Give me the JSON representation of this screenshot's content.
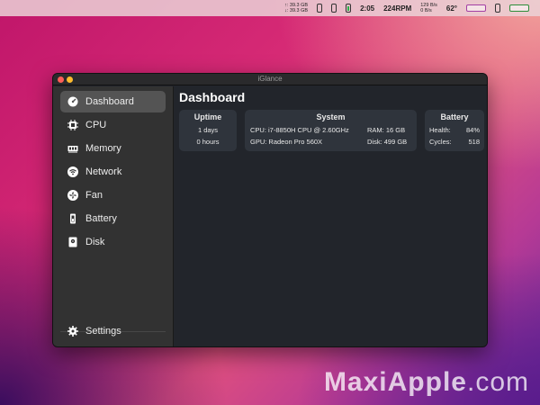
{
  "menubar": {
    "net_upload": "↑: 39.3 GB",
    "net_download": "↓: 39.3 GB",
    "time": "2:05",
    "fan": "224RPM",
    "net_rate_up": "129 B/s",
    "net_rate_down": "0 B/s",
    "temp": "62°"
  },
  "window": {
    "title": "iGlance"
  },
  "sidebar": {
    "items": [
      {
        "label": "Dashboard",
        "icon": "gauge-icon"
      },
      {
        "label": "CPU",
        "icon": "cpu-icon"
      },
      {
        "label": "Memory",
        "icon": "memory-icon"
      },
      {
        "label": "Network",
        "icon": "wifi-icon"
      },
      {
        "label": "Fan",
        "icon": "fan-icon"
      },
      {
        "label": "Battery",
        "icon": "battery-icon"
      },
      {
        "label": "Disk",
        "icon": "disk-icon"
      }
    ],
    "settings_label": "Settings"
  },
  "main": {
    "title": "Dashboard",
    "uptime": {
      "header": "Uptime",
      "days": "1 days",
      "hours": "0 hours"
    },
    "system": {
      "header": "System",
      "cpu": "CPU: i7-8850H CPU @ 2.60GHz",
      "gpu": "GPU: Radeon Pro 560X",
      "ram": "RAM: 16 GB",
      "disk": "Disk: 499 GB"
    },
    "battery": {
      "header": "Battery",
      "health_label": "Health:",
      "health_value": "84%",
      "cycles_label": "Cycles:",
      "cycles_value": "518"
    }
  },
  "watermark": {
    "part1": "Maxi",
    "part2": "Apple",
    "part3": ".com"
  },
  "colors": {
    "sidebar_bg": "#323232",
    "main_bg": "#22252b",
    "card_bg": "#2f343c",
    "active_item": "#545454"
  }
}
